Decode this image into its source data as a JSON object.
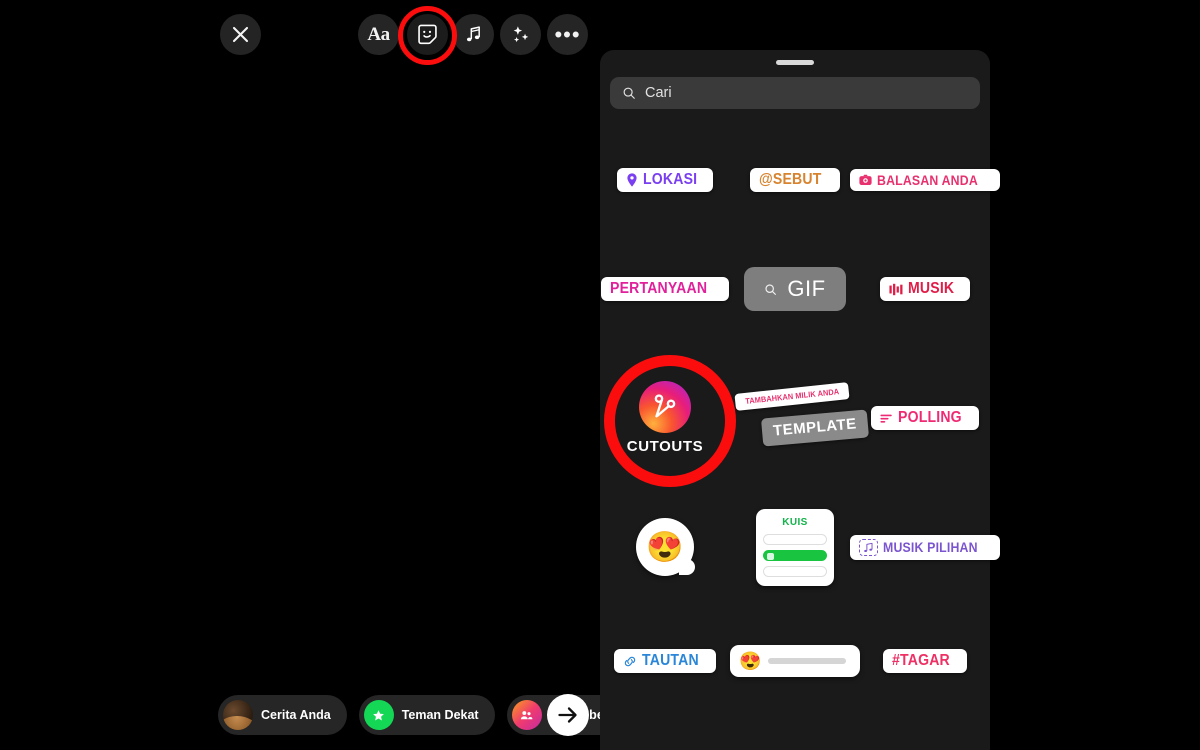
{
  "app": {
    "name": "Instagram Story Editor",
    "background_color": "#000000",
    "highlight_color": "#fc0d0d"
  },
  "toolbar": {
    "close_label": "close-icon",
    "items": [
      {
        "id": "text",
        "label": "Aa",
        "icon": "text-icon",
        "highlighted": false
      },
      {
        "id": "sticker",
        "label": "",
        "icon": "sticker-smiley-icon",
        "highlighted": true
      },
      {
        "id": "music",
        "label": "",
        "icon": "music-note-icon",
        "highlighted": false
      },
      {
        "id": "effects",
        "label": "",
        "icon": "sparkles-icon",
        "highlighted": false
      },
      {
        "id": "more",
        "label": "",
        "icon": "more-dots-icon",
        "highlighted": false
      }
    ]
  },
  "share_bar": {
    "chips": [
      {
        "id": "your-story",
        "label": "Cerita Anda",
        "avatar": "profile-photo-avatar"
      },
      {
        "id": "close-friends",
        "label": "Teman Dekat",
        "avatar": "green-star-avatar"
      },
      {
        "id": "share-list",
        "label": "Daftar berbagi",
        "avatar": "gradient-group-avatar"
      }
    ],
    "send_label": "arrow-right-icon"
  },
  "sticker_tray": {
    "grabber": "drag-handle",
    "search": {
      "placeholder": "Cari",
      "value": "Cari",
      "icon": "search-icon"
    },
    "rows": [
      {
        "id": "row-1",
        "stickers": [
          {
            "id": "lokasi",
            "type": "pill",
            "label": "LOKASI",
            "icon": "location-pin-icon",
            "color": "#7a3ff0"
          },
          {
            "id": "sebut",
            "type": "pill",
            "label": "@SEBUT",
            "icon": "",
            "color": "#d8832e"
          },
          {
            "id": "balasan-anda",
            "type": "pill",
            "label": "BALASAN ANDA",
            "icon": "camera-icon",
            "color": "#e8306f"
          }
        ]
      },
      {
        "id": "row-2",
        "stickers": [
          {
            "id": "pertanyaan",
            "type": "pill-stack",
            "label": "PERTANYAAN",
            "icon": "",
            "color": "#e0219b"
          },
          {
            "id": "gif",
            "type": "gif",
            "label": "GIF",
            "icon": "search-icon",
            "color": "#ffffff"
          },
          {
            "id": "musik",
            "type": "pill",
            "label": "MUSIK",
            "icon": "equalizer-bars-icon",
            "color": "#e01d47"
          }
        ]
      },
      {
        "id": "row-3",
        "stickers": [
          {
            "id": "cutouts",
            "type": "cutouts",
            "label": "CUTOUTS",
            "icon": "scissors-icon",
            "highlighted": true
          },
          {
            "id": "template",
            "type": "template",
            "label": "TEMPLATE",
            "top_label": "TAMBAHKAN MILIK ANDA",
            "color": "#e8306f"
          },
          {
            "id": "polling",
            "type": "pill",
            "label": "POLLING",
            "icon": "poll-bars-icon",
            "color": "#ef2a74"
          }
        ]
      },
      {
        "id": "row-4",
        "stickers": [
          {
            "id": "reaksi-emoji",
            "type": "emoji-bubble",
            "label": "",
            "emoji": "😍"
          },
          {
            "id": "kuis",
            "type": "quiz",
            "label": "KUIS",
            "color": "#12b34a",
            "options": 3,
            "selected_index": 1
          },
          {
            "id": "musik-pilihan",
            "type": "pill",
            "label": "MUSIK PILIHAN",
            "icon": "music-notes-dashed-icon",
            "color": "#7b55cf"
          }
        ]
      },
      {
        "id": "row-5",
        "stickers": [
          {
            "id": "tautan",
            "type": "pill",
            "label": "TAUTAN",
            "icon": "link-chain-icon",
            "color": "#2a86d8"
          },
          {
            "id": "emoji-slider",
            "type": "slider",
            "label": "",
            "emoji": "😍"
          },
          {
            "id": "tagar",
            "type": "pill",
            "label": "#TAGAR",
            "icon": "",
            "color": "#ee3064"
          }
        ]
      }
    ]
  }
}
